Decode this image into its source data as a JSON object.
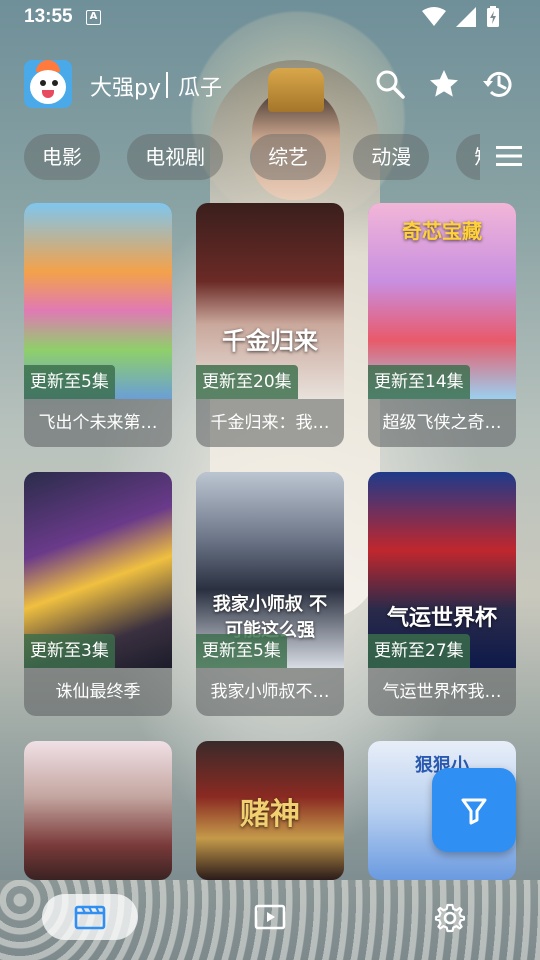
{
  "status_bar": {
    "time": "13:55",
    "notification_badge": "A",
    "icons": [
      "wifi-icon",
      "cell-signal-icon",
      "battery-charging-icon"
    ]
  },
  "header": {
    "source_name": "大强py",
    "site_name": "瓜子",
    "icons": [
      "search-icon",
      "star-icon",
      "history-icon"
    ]
  },
  "categories": [
    "电影",
    "电视剧",
    "综艺",
    "动漫",
    "短"
  ],
  "cards": [
    {
      "badge": "更新至5集",
      "title": "飞出个未来第…",
      "poster_caption": ""
    },
    {
      "badge": "更新至20集",
      "title": "千金归来：我…",
      "poster_caption": "千金归来"
    },
    {
      "badge": "更新至14集",
      "title": "超级飞侠之奇…",
      "poster_caption": "奇芯宝藏"
    },
    {
      "badge": "更新至3集",
      "title": "诛仙最终季",
      "poster_caption": ""
    },
    {
      "badge": "更新至5集",
      "title": "我家小师叔不…",
      "poster_caption": "我家小师叔 不可能这么强"
    },
    {
      "badge": "更新至27集",
      "title": "气运世界杯我…",
      "poster_caption": "气运世界杯"
    },
    {
      "badge": "",
      "title": "",
      "poster_caption": ""
    },
    {
      "badge": "",
      "title": "",
      "poster_caption": "赌神"
    },
    {
      "badge": "",
      "title": "",
      "poster_caption": "狠狠小"
    }
  ],
  "colors": {
    "accent": "#2f8ff2",
    "badge_bg": "#3a6e4a"
  },
  "bottom_nav": {
    "items": [
      "clapperboard-icon",
      "play-video-icon",
      "settings-icon"
    ]
  }
}
